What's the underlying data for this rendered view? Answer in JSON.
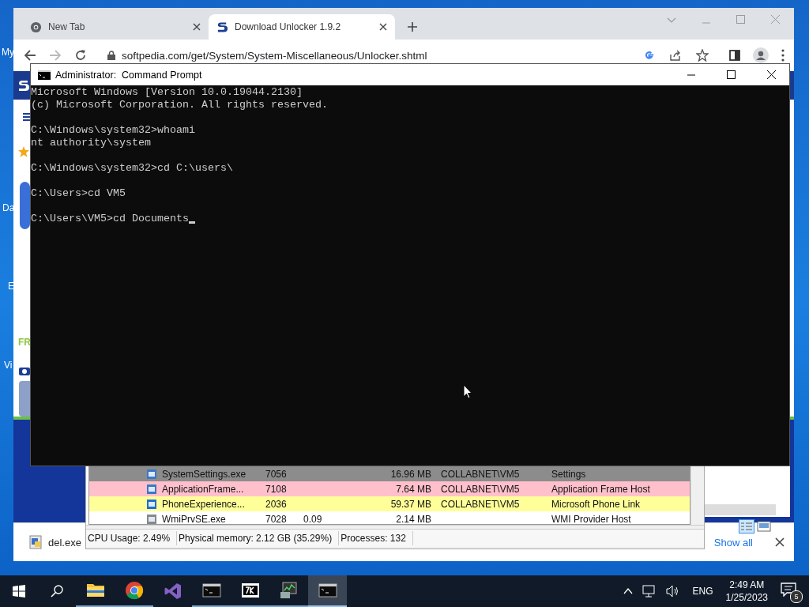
{
  "desktop": {
    "icon_labels": [
      "My",
      "Da",
      "E",
      "Vi"
    ]
  },
  "browser": {
    "tabs": [
      {
        "title": "New Tab",
        "selected": false
      },
      {
        "title": "Download Unlocker 1.9.2",
        "selected": true
      }
    ],
    "address": "softpedia.com/get/System/System-Miscellaneous/Unlocker.shtml",
    "page_fragment": "FR",
    "downloads": {
      "file": "del.exe",
      "show_all": "Show all"
    }
  },
  "task_manager": {
    "rows": [
      {
        "name": "SystemSettings.exe",
        "pid": "7056",
        "cpu": "",
        "memory": "16.96 MB",
        "user": "COLLABNET\\VM5",
        "description": "Settings",
        "color": "#8c8c8c"
      },
      {
        "name": "ApplicationFrame...",
        "pid": "7108",
        "cpu": "",
        "memory": "7.64 MB",
        "user": "COLLABNET\\VM5",
        "description": "Application Frame Host",
        "color": "#ffc0cb"
      },
      {
        "name": "PhoneExperience...",
        "pid": "2036",
        "cpu": "",
        "memory": "59.37 MB",
        "user": "COLLABNET\\VM5",
        "description": "Microsoft Phone Link",
        "color": "#ffff99"
      },
      {
        "name": "WmiPrvSE.exe",
        "pid": "7028",
        "cpu": "0.09",
        "memory": "2.14 MB",
        "user": "",
        "description": "WMI Provider Host",
        "color": "#ffffff"
      }
    ],
    "status": [
      "CPU Usage: 2.49%",
      "Physical memory: 2.12 GB (35.29%)",
      "Processes: 132"
    ]
  },
  "console": {
    "title": "Administrator:  Command Prompt",
    "blocks": [
      [
        "Microsoft Windows [Version 10.0.19044.2130]",
        "(c) Microsoft Corporation. All rights reserved."
      ],
      [
        "C:\\Windows\\system32>whoami",
        "nt authority\\system"
      ],
      [
        "C:\\Windows\\system32>cd C:\\users\\"
      ],
      [
        "C:\\Users>cd VM5"
      ],
      [
        "C:\\Users\\VM5>cd Documents"
      ]
    ],
    "cursor": true
  },
  "taskbar": {
    "apps": [
      {
        "kind": "explorer",
        "running": true,
        "active": false
      },
      {
        "kind": "chrome",
        "running": true,
        "active": false
      },
      {
        "kind": "studio",
        "running": false,
        "active": false
      },
      {
        "kind": "console",
        "running": true,
        "active": false
      },
      {
        "kind": "archiver",
        "running": true,
        "active": false
      },
      {
        "kind": "monitor",
        "running": true,
        "active": false
      },
      {
        "kind": "console",
        "running": true,
        "active": true
      }
    ],
    "language": "ENG",
    "time": "2:49 AM",
    "date": "1/25/2023",
    "notifications": "5"
  }
}
